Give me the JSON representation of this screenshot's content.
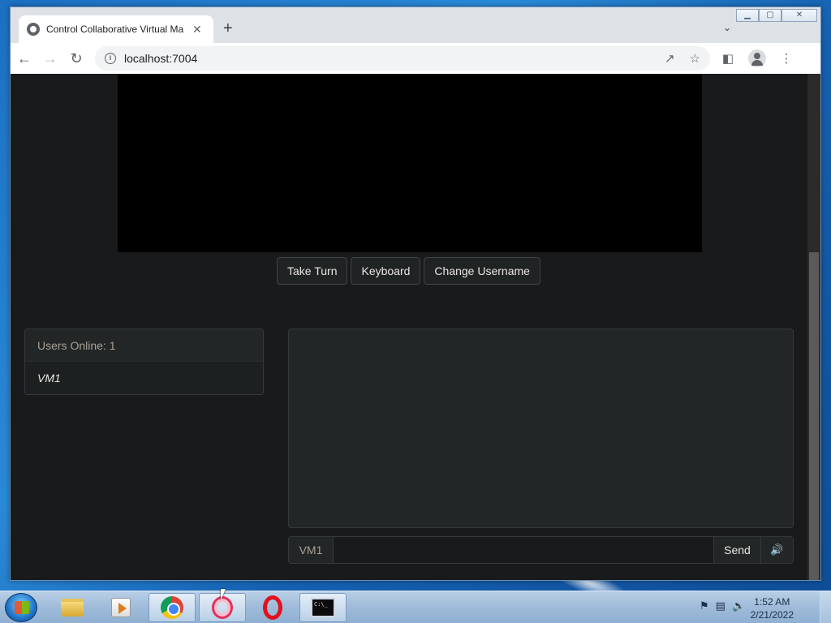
{
  "browser": {
    "tab_title": "Control Collaborative Virtual Ma",
    "tab_close": "✕",
    "new_tab": "+",
    "tab_list": "⌄",
    "win_minimize": "▁",
    "win_restore": "▢",
    "win_close": "✕",
    "url": "localhost:7004",
    "icons": [
      "back-icon",
      "forward-icon",
      "reload-icon",
      "info-icon",
      "share-icon",
      "star-icon",
      "sidepanel-icon",
      "profile-icon",
      "menu-icon"
    ]
  },
  "vm_controls": {
    "take_turn": "Take Turn",
    "keyboard": "Keyboard",
    "change_username": "Change Username"
  },
  "users": {
    "header": "Users Online: 1",
    "list": [
      "VM1"
    ]
  },
  "chat": {
    "username": "VM1",
    "input_value": "",
    "send": "Send",
    "sound_icon": "🔊"
  },
  "taskbar": {
    "apps": [
      "windows-explorer",
      "media-player",
      "chrome",
      "opera-gx",
      "opera",
      "command-prompt"
    ],
    "clock_time": "1:52 AM",
    "clock_date": "2/21/2022"
  },
  "colors": {
    "page_bg": "#181a1b",
    "panel_bg": "#232627",
    "text": "#e8e6e3",
    "muted_text": "#a8a095"
  }
}
